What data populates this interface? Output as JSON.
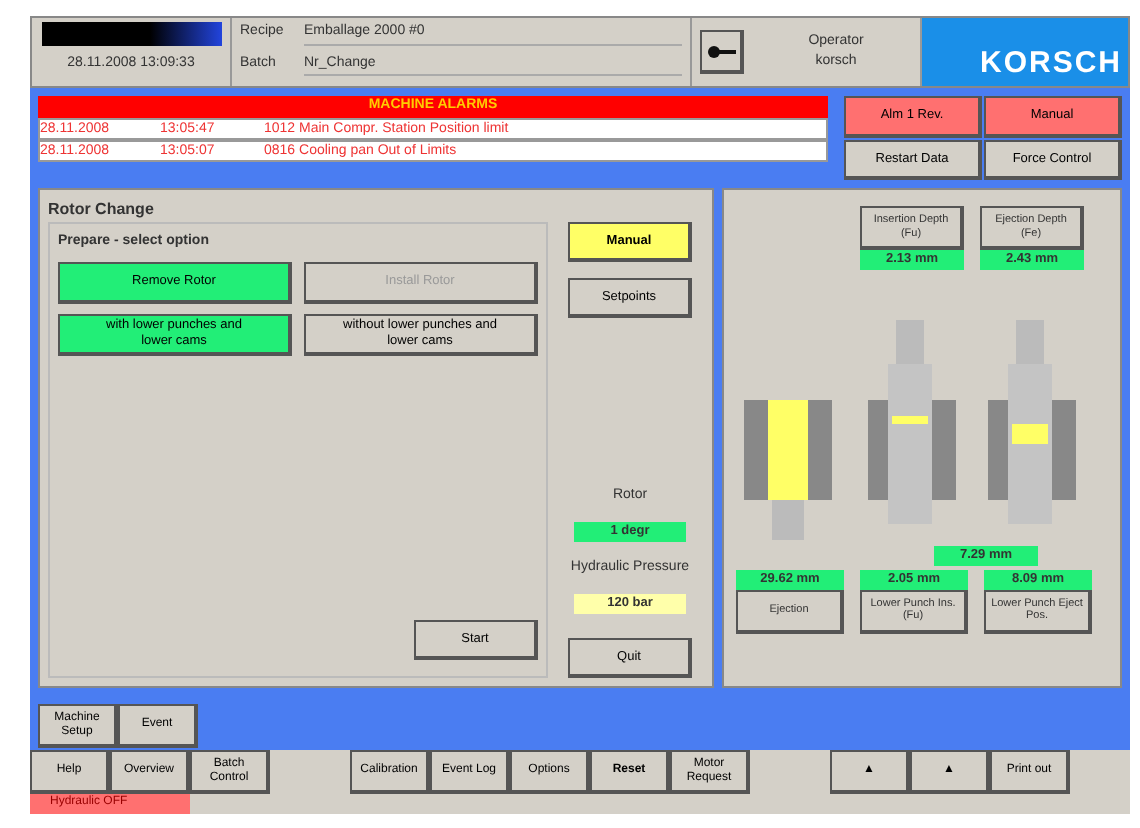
{
  "header": {
    "clock": "28.11.2008 13:09:33",
    "recipe_label": "Recipe",
    "recipe": "Emballage 2000 #0",
    "batch_label": "Batch",
    "batch": "Nr_Change",
    "operator_label": "Operator",
    "operator": "korsch",
    "logo": "KORSCH"
  },
  "alarms": {
    "title": "MACHINE ALARMS",
    "rows": [
      {
        "date": "28.11.2008",
        "time": "13:05:47",
        "message": "1012 Main Compr. Station Position limit"
      },
      {
        "date": "28.11.2008",
        "time": "13:05:07",
        "message": "0816 Cooling pan Out of Limits"
      }
    ],
    "buttons": [
      {
        "label": "Alm 1 Rev.",
        "kind": "alarm"
      },
      {
        "label": "Manual",
        "kind": "alarm"
      },
      {
        "label": "Restart Data",
        "kind": "normal"
      },
      {
        "label": "Force Control",
        "kind": "normal"
      }
    ]
  },
  "rotor_change": {
    "title": "Rotor Change",
    "group_title": "Prepare - select option",
    "options": [
      {
        "label": "Remove Rotor",
        "kind": "active"
      },
      {
        "label": "Install Rotor",
        "kind": "disabled"
      },
      {
        "label": "with lower punches and lower cams",
        "kind": "active"
      },
      {
        "label": "without lower punches and lower cams",
        "kind": "normal"
      }
    ],
    "side_buttons": [
      {
        "label": "Manual",
        "kind": "warning"
      },
      {
        "label": "Setpoints",
        "kind": "normal"
      }
    ],
    "start": "Start",
    "rotor_label": "Rotor",
    "rotor_value": "1 degr",
    "pressure_label": "Hydraulic Pressure",
    "pressure_value": "120 bar",
    "quit": "Quit"
  },
  "depths": {
    "top": [
      {
        "label": "Insertion Depth (Fu)",
        "value": "2.13 mm"
      },
      {
        "label": "Ejection Depth (Fe)",
        "value": "2.43 mm"
      }
    ],
    "middle_value": "7.29 mm",
    "bottom": [
      {
        "label": "Ejection",
        "value": "29.62 mm"
      },
      {
        "label": "Lower Punch Ins. (Fu)",
        "value": "2.05 mm"
      },
      {
        "label": "Lower Punch Eject Pos.",
        "value": "8.09 mm"
      }
    ]
  },
  "nav_top": [
    "Machine Setup",
    "Event"
  ],
  "nav_bottom": [
    {
      "label": "Help",
      "kind": "normal"
    },
    {
      "label": "Overview",
      "kind": "normal"
    },
    {
      "label": "Batch Control",
      "kind": "normal"
    },
    {
      "kind": "gap"
    },
    {
      "label": "Calibration",
      "kind": "normal"
    },
    {
      "label": "Event Log",
      "kind": "normal"
    },
    {
      "label": "Options",
      "kind": "normal"
    },
    {
      "label": "Reset",
      "kind": "bold"
    },
    {
      "label": "Motor Request",
      "kind": "normal"
    },
    {
      "kind": "gap"
    },
    {
      "label": "▲",
      "kind": "normal"
    },
    {
      "label": "▲",
      "kind": "normal"
    },
    {
      "label": "Print out",
      "kind": "normal"
    }
  ],
  "status": {
    "hydraulic": "Hydraulic OFF"
  }
}
